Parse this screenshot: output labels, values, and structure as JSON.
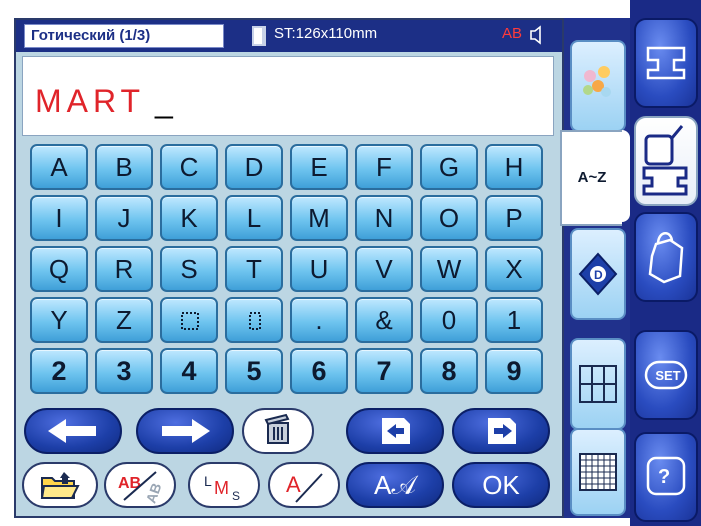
{
  "header": {
    "font_name": "Готический (1/3)",
    "size_text": "ST:126x110mm",
    "ab_label": "AB"
  },
  "text_display": {
    "value": "MART",
    "cursor": "_"
  },
  "keys": [
    "A",
    "B",
    "C",
    "D",
    "E",
    "F",
    "G",
    "H",
    "I",
    "J",
    "K",
    "L",
    "M",
    "N",
    "O",
    "P",
    "Q",
    "R",
    "S",
    "T",
    "U",
    "V",
    "W",
    "X",
    "Y",
    "Z",
    "⬚",
    "⠿",
    ".",
    "&",
    "0",
    "1",
    "2",
    "3",
    "4",
    "5",
    "6",
    "7",
    "8",
    "9"
  ],
  "bottom_buttons": {
    "ok_label": "OK",
    "aa_label": "A𝒜",
    "lms_label": "LMS"
  },
  "tabs": {
    "az_label": "A~Z"
  },
  "side_panel": {
    "set_label": "SET",
    "help_label": "?"
  },
  "colors": {
    "header_bg": "#1c2f86",
    "text_red": "#e0242a",
    "key_blue": "#6ec4ef",
    "panel_bg": "#bcd6e3",
    "side_bg": "#1a2a86"
  }
}
